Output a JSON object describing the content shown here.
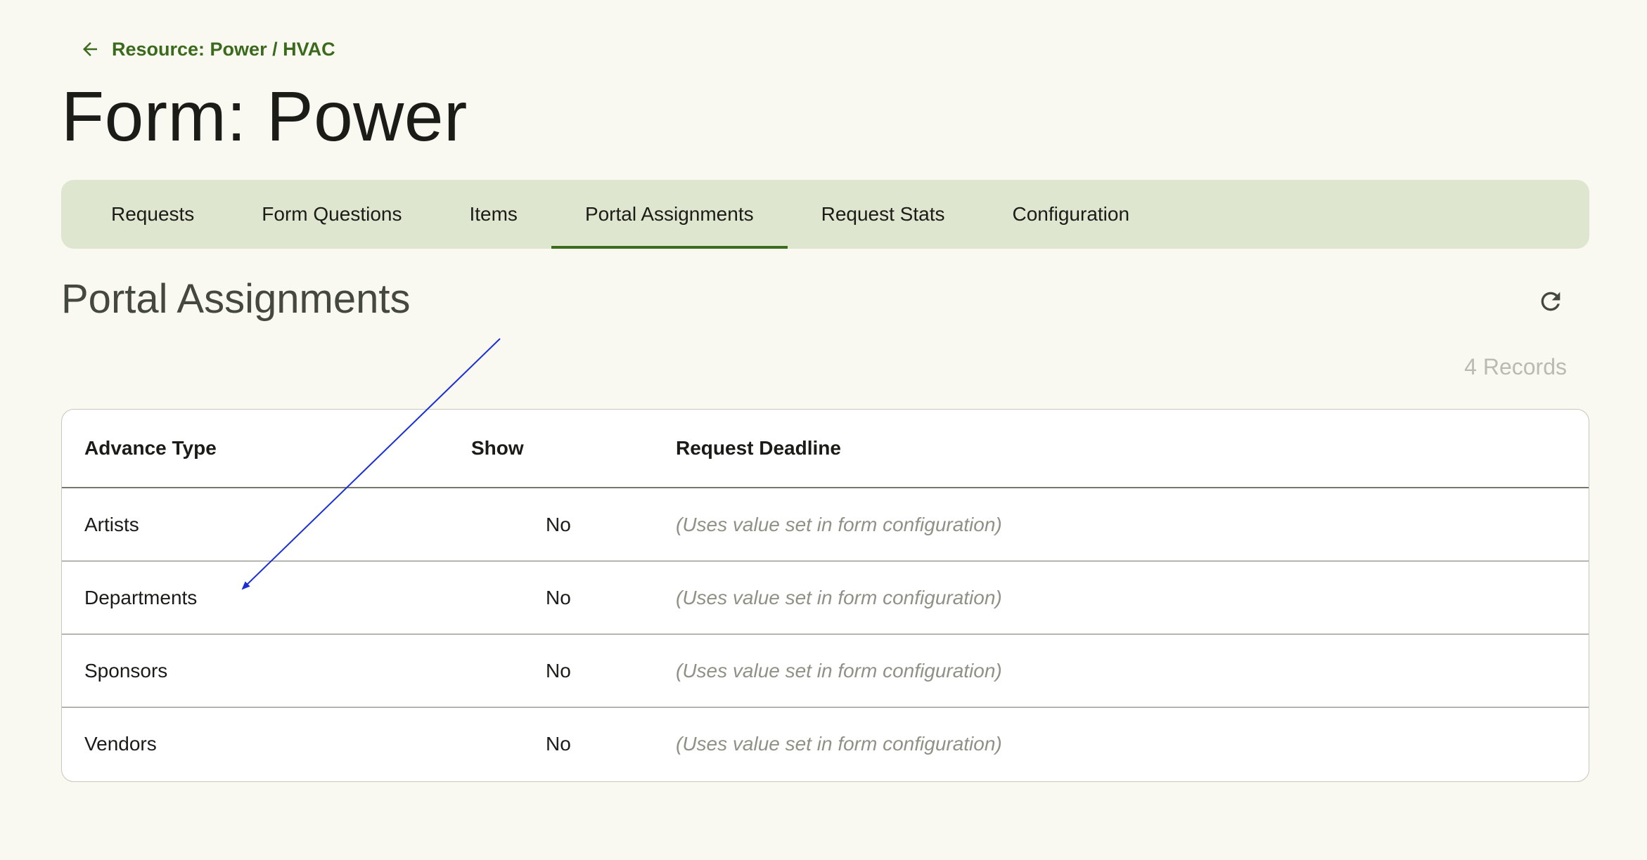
{
  "breadcrumb": {
    "back_label": "Resource: Power / HVAC",
    "icon": "arrow-left-icon"
  },
  "page": {
    "title": "Form: Power"
  },
  "tabs": [
    {
      "label": "Requests",
      "active": false
    },
    {
      "label": "Form Questions",
      "active": false
    },
    {
      "label": "Items",
      "active": false
    },
    {
      "label": "Portal Assignments",
      "active": true
    },
    {
      "label": "Request Stats",
      "active": false
    },
    {
      "label": "Configuration",
      "active": false
    }
  ],
  "section": {
    "title": "Portal Assignments",
    "refresh_icon": "refresh-icon",
    "record_count": "4 Records"
  },
  "table": {
    "headers": [
      "Advance Type",
      "Show",
      "Request Deadline"
    ],
    "rows": [
      {
        "type": "Artists",
        "show": "No",
        "deadline": "(Uses value set in form configuration)"
      },
      {
        "type": "Departments",
        "show": "No",
        "deadline": "(Uses value set in form configuration)"
      },
      {
        "type": "Sponsors",
        "show": "No",
        "deadline": "(Uses value set in form configuration)"
      },
      {
        "type": "Vendors",
        "show": "No",
        "deadline": "(Uses value set in form configuration)"
      }
    ]
  },
  "colors": {
    "background": "#f9f9f2",
    "accent": "#3b6a1d",
    "tab_bar": "#dee6cf",
    "annotation_arrow": "#1a2fd6"
  }
}
